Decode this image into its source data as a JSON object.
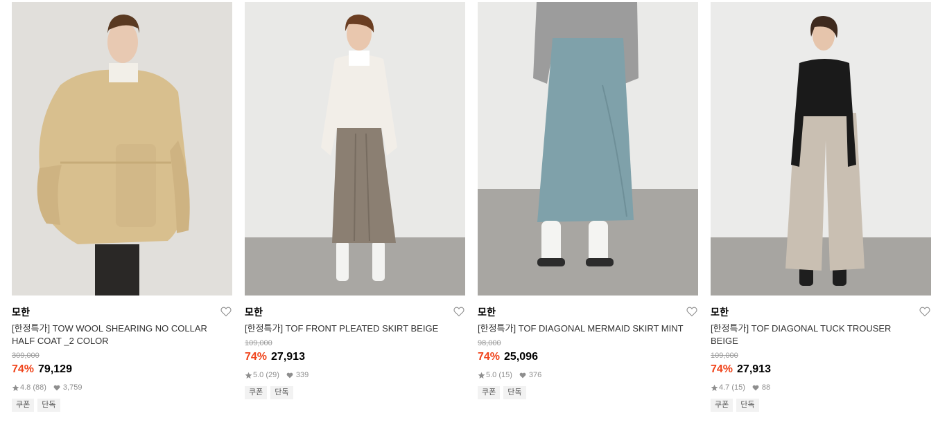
{
  "colors": {
    "discount": "#f0441b",
    "muted": "#9a9a9a",
    "tag_bg": "#f2f2f2"
  },
  "products": [
    {
      "brand": "모한",
      "name": "[한정특가] TOW WOOL SHEARING NO COLLAR HALF COAT _2 COLOR",
      "original_price": "309,000",
      "discount": "74%",
      "price": "79,129",
      "rating": "4.8 (88)",
      "likes": "3,759",
      "tags": [
        "쿠폰",
        "단독"
      ],
      "like_icon": "heart-outline-icon"
    },
    {
      "brand": "모한",
      "name": "[한정특가] TOF FRONT PLEATED SKIRT BEIGE",
      "original_price": "109,000",
      "discount": "74%",
      "price": "27,913",
      "rating": "5.0 (29)",
      "likes": "339",
      "tags": [
        "쿠폰",
        "단독"
      ],
      "like_icon": "heart-outline-icon"
    },
    {
      "brand": "모한",
      "name": "[한정특가] TOF DIAGONAL MERMAID SKIRT MINT",
      "original_price": "98,000",
      "discount": "74%",
      "price": "25,096",
      "rating": "5.0 (15)",
      "likes": "376",
      "tags": [
        "쿠폰",
        "단독"
      ],
      "like_icon": "heart-outline-icon"
    },
    {
      "brand": "모한",
      "name": "[한정특가] TOF DIAGONAL TUCK TROUSER BEIGE",
      "original_price": "109,000",
      "discount": "74%",
      "price": "27,913",
      "rating": "4.7 (15)",
      "likes": "88",
      "tags": [
        "쿠폰",
        "단독"
      ],
      "like_icon": "heart-outline-icon"
    }
  ]
}
